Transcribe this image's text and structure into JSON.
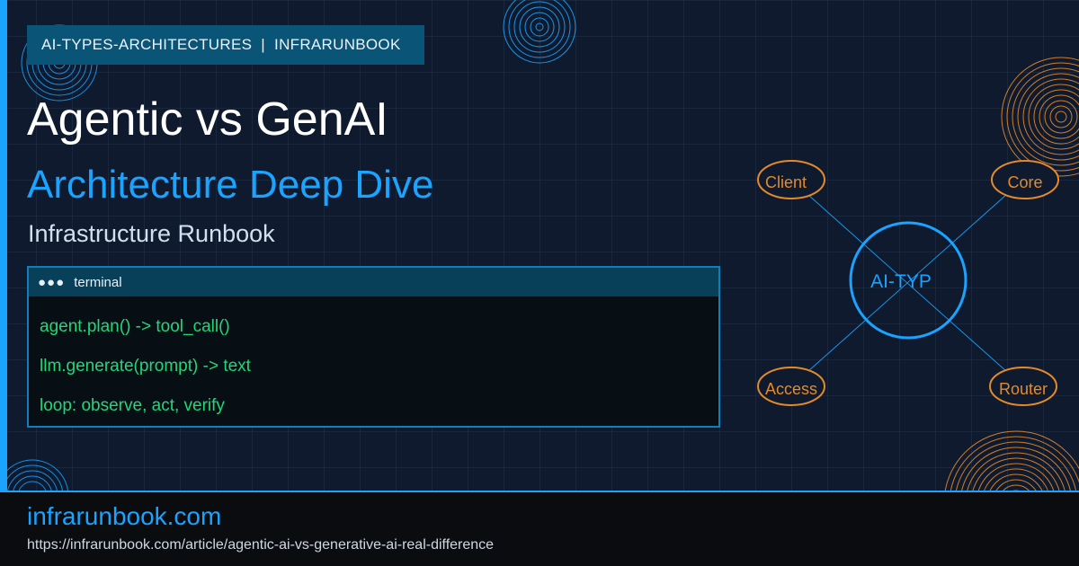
{
  "tag": "AI-TYPES-ARCHITECTURES  |  INFRARUNBOOK",
  "title": "Agentic vs GenAI",
  "subtitle": "Architecture Deep Dive",
  "brand_line": "Infrastructure Runbook",
  "terminal": {
    "dots": "●●●",
    "title": "terminal",
    "lines": [
      "agent.plan() -> tool_call()",
      "llm.generate(prompt) -> text",
      "loop: observe, act, verify"
    ]
  },
  "diagram": {
    "hub": "AI-TYP",
    "nodes": [
      "Client",
      "Core",
      "Access",
      "Router"
    ]
  },
  "footer": {
    "domain": "infrarunbook.com",
    "url": "https://infrarunbook.com/article/agentic-ai-vs-generative-ai-real-difference"
  },
  "colors": {
    "accent": "#1aa3ff",
    "orange": "#e38a2c",
    "terminal_green": "#22d67a",
    "background": "#0f1a2e"
  }
}
